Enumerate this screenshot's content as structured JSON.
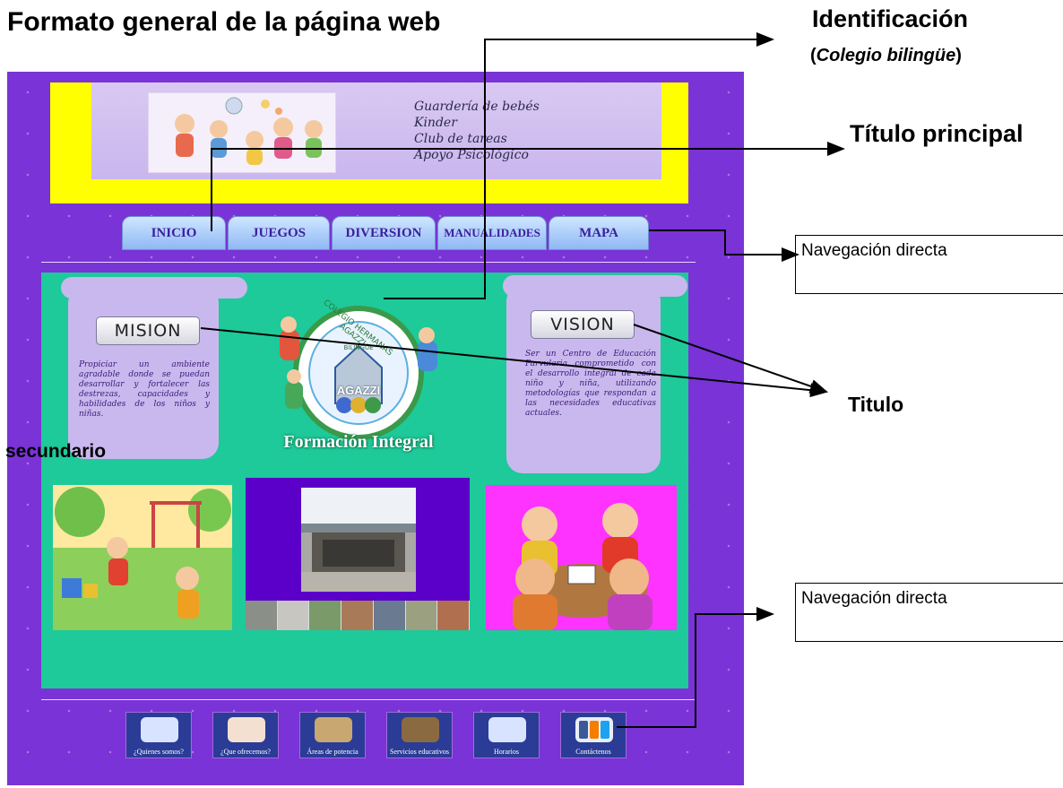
{
  "diagram": {
    "title": "Formato general de la página web",
    "annotations": {
      "identificacion": "Identificación",
      "identificacion_sub_open": "(",
      "identificacion_sub": "Colegio bilingüe",
      "identificacion_sub_close": ")",
      "titulo_principal": "Título principal",
      "navegacion_1": "Navegación directa",
      "titulo": "Titulo",
      "secundario": "secundario",
      "navegacion_2": "Navegación directa"
    }
  },
  "mock_site": {
    "header_list": [
      "Guardería de bebés",
      "Kinder",
      "Club de tareas",
      "Apoyo Psicológico"
    ],
    "nav_tabs": [
      "INICIO",
      "JUEGOS",
      "DIVERSION",
      "MANUALIDADES",
      "MAPA"
    ],
    "mision": {
      "label": "MISION",
      "text": "Propiciar un ambiente agradable donde se puedan desarrollar y fortalecer las destrezas, capacidades y habilidades de los niños y niñas."
    },
    "vision": {
      "label": "VISION",
      "text": "Ser un Centro de Educación Parvularia comprometido con el desarrollo integral de cada niño y niña, utilizando metodologías que respondan a las necesidades educativas actuales."
    },
    "logo": {
      "ring_text": "COLEGIO HERMANAS AGAZZI",
      "subring": "BILINGÜE",
      "name": "AGAZZI",
      "banner": "Formación Integral"
    },
    "footer_links": [
      "¿Quienes somos?",
      "¿Que ofrecemos?",
      "Áreas de potencia",
      "Servicios educativos",
      "Horarios",
      "Contáctenos"
    ],
    "colors": {
      "page_bg": "#7a33d6",
      "header_yellow": "#ffff00",
      "content_green": "#1ec99a",
      "tab_blue": "#8fb8f4",
      "scroll_lilac": "#c9b8ee",
      "kids_magenta": "#ff33ff",
      "school_purple": "#5a00c8"
    }
  }
}
